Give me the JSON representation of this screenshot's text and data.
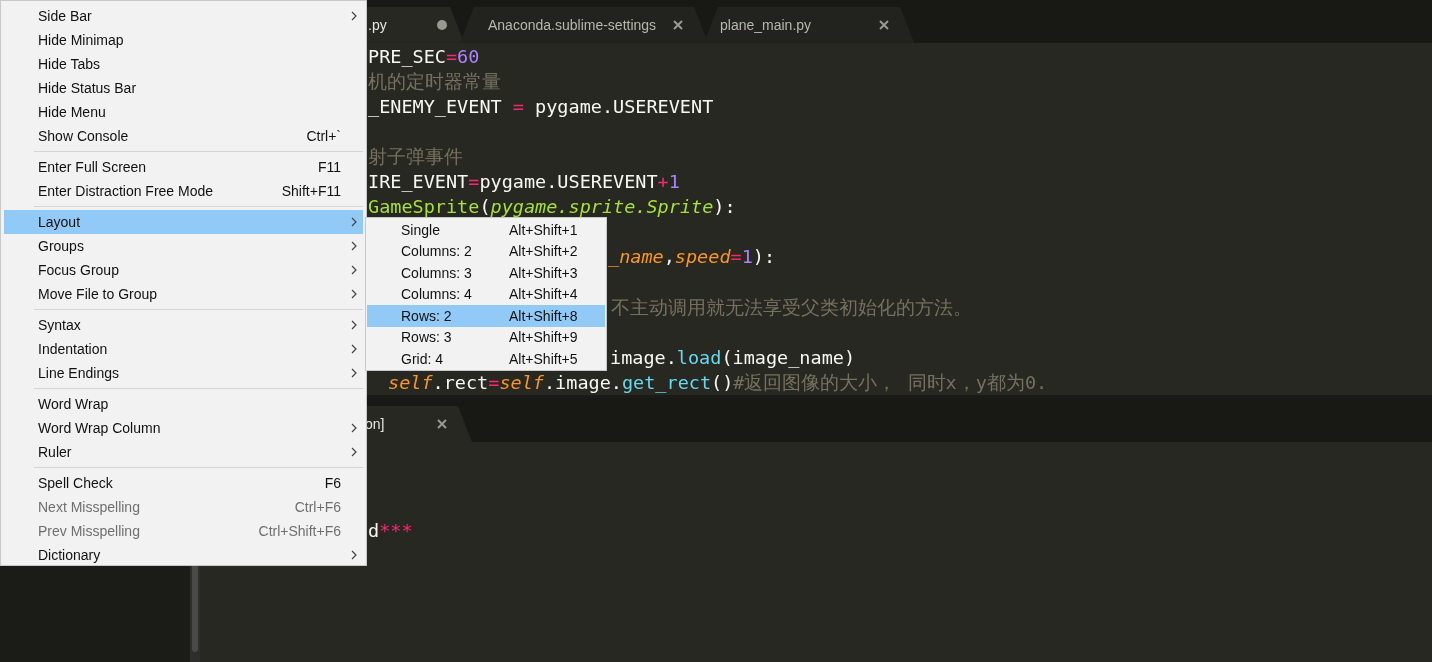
{
  "top_pane": {
    "tabs": [
      {
        "label": ".py",
        "selected": true,
        "dirty": true
      },
      {
        "label": "Anaconda.sublime-settings",
        "selected": false,
        "dirty": false
      },
      {
        "label": "plane_main.py",
        "selected": false,
        "dirty": false
      }
    ],
    "code_lines": [
      {
        "segments": [
          {
            "text": "PRE_SEC",
            "kind": "plain"
          },
          {
            "text": "=",
            "kind": "operator"
          },
          {
            "text": "60",
            "kind": "number"
          }
        ]
      },
      {
        "segments": [
          {
            "text": "机的定时器常量",
            "kind": "comment"
          }
        ]
      },
      {
        "segments": [
          {
            "text": "_ENEMY_EVENT ",
            "kind": "plain"
          },
          {
            "text": "=",
            "kind": "operator"
          },
          {
            "text": " pygame.USEREVENT",
            "kind": "plain"
          }
        ]
      },
      {
        "segments": [
          {
            "text": "射子弹事件",
            "kind": "comment"
          }
        ]
      },
      {
        "segments": [
          {
            "text": "IRE_EVENT",
            "kind": "plain"
          },
          {
            "text": "=",
            "kind": "operator"
          },
          {
            "text": "pygame.USEREVENT",
            "kind": "plain"
          },
          {
            "text": "+",
            "kind": "operator"
          },
          {
            "text": "1",
            "kind": "number"
          }
        ]
      },
      {
        "segments": [
          {
            "text": "GameSprite",
            "kind": "class"
          },
          {
            "text": "(",
            "kind": "plain"
          },
          {
            "text": "pygame.sprite.Sprite",
            "kind": "base"
          },
          {
            "text": "):",
            "kind": "plain"
          }
        ]
      },
      {
        "segments": [
          {
            "text": "_name",
            "kind": "param"
          },
          {
            "text": ",",
            "kind": "plain"
          },
          {
            "text": "speed",
            "kind": "param"
          },
          {
            "text": "=",
            "kind": "operator"
          },
          {
            "text": "1",
            "kind": "number"
          },
          {
            "text": "):",
            "kind": "plain"
          }
        ]
      },
      {
        "segments": [
          {
            "text": "不主动调用就无法享受父类初始化的方法。",
            "kind": "comment"
          }
        ]
      },
      {
        "segments": [
          {
            "text": "image.",
            "kind": "plain"
          },
          {
            "text": "load",
            "kind": "function"
          },
          {
            "text": "(image_name)",
            "kind": "plain"
          }
        ]
      },
      {
        "segments": [
          {
            "text": "self",
            "kind": "param"
          },
          {
            "text": ".rect",
            "kind": "plain"
          },
          {
            "text": "=",
            "kind": "operator"
          },
          {
            "text": "self",
            "kind": "param"
          },
          {
            "text": ".image.",
            "kind": "plain"
          },
          {
            "text": "get_rect",
            "kind": "function"
          },
          {
            "text": "()",
            "kind": "plain"
          },
          {
            "text": "#返回图像的大小， 同时x，y都为0.",
            "kind": "comment"
          }
        ]
      }
    ]
  },
  "bottom_pane": {
    "tabs": [
      {
        "label": "on]",
        "selected": true,
        "dirty": false
      }
    ],
    "code_lines": [
      {
        "segments": [
          {
            "text": "d",
            "kind": "plain"
          },
          {
            "text": "***",
            "kind": "operator"
          }
        ]
      }
    ]
  },
  "view_menu": {
    "sections": [
      [
        {
          "label": "Side Bar",
          "submenu": true,
          "selected": false,
          "disabled": false
        },
        {
          "label": "Hide Minimap",
          "submenu": false,
          "selected": false,
          "disabled": false
        },
        {
          "label": "Hide Tabs",
          "submenu": false,
          "selected": false,
          "disabled": false
        },
        {
          "label": "Hide Status Bar",
          "submenu": false,
          "selected": false,
          "disabled": false
        },
        {
          "label": "Hide Menu",
          "submenu": false,
          "selected": false,
          "disabled": false
        },
        {
          "label": "Show Console",
          "shortcut": "Ctrl+`",
          "submenu": false,
          "selected": false,
          "disabled": false
        }
      ],
      [
        {
          "label": "Enter Full Screen",
          "shortcut": "F11",
          "submenu": false,
          "selected": false,
          "disabled": false
        },
        {
          "label": "Enter Distraction Free Mode",
          "shortcut": "Shift+F11",
          "submenu": false,
          "selected": false,
          "disabled": false
        }
      ],
      [
        {
          "label": "Layout",
          "submenu": true,
          "selected": true,
          "disabled": false
        },
        {
          "label": "Groups",
          "submenu": true,
          "selected": false,
          "disabled": false
        },
        {
          "label": "Focus Group",
          "submenu": true,
          "selected": false,
          "disabled": false
        },
        {
          "label": "Move File to Group",
          "submenu": true,
          "selected": false,
          "disabled": false
        }
      ],
      [
        {
          "label": "Syntax",
          "submenu": true,
          "selected": false,
          "disabled": false
        },
        {
          "label": "Indentation",
          "submenu": true,
          "selected": false,
          "disabled": false
        },
        {
          "label": "Line Endings",
          "submenu": true,
          "selected": false,
          "disabled": false
        }
      ],
      [
        {
          "label": "Word Wrap",
          "submenu": false,
          "selected": false,
          "disabled": false
        },
        {
          "label": "Word Wrap Column",
          "submenu": true,
          "selected": false,
          "disabled": false
        },
        {
          "label": "Ruler",
          "submenu": true,
          "selected": false,
          "disabled": false
        }
      ],
      [
        {
          "label": "Spell Check",
          "shortcut": "F6",
          "submenu": false,
          "selected": false,
          "disabled": false
        },
        {
          "label": "Next Misspelling",
          "shortcut": "Ctrl+F6",
          "submenu": false,
          "selected": false,
          "disabled": true
        },
        {
          "label": "Prev Misspelling",
          "shortcut": "Ctrl+Shift+F6",
          "submenu": false,
          "selected": false,
          "disabled": true
        },
        {
          "label": "Dictionary",
          "submenu": true,
          "selected": false,
          "disabled": false
        }
      ]
    ]
  },
  "layout_submenu": {
    "items": [
      {
        "label": "Single",
        "shortcut": "Alt+Shift+1",
        "selected": false
      },
      {
        "label": "Columns: 2",
        "shortcut": "Alt+Shift+2",
        "selected": false
      },
      {
        "label": "Columns: 3",
        "shortcut": "Alt+Shift+3",
        "selected": false
      },
      {
        "label": "Columns: 4",
        "shortcut": "Alt+Shift+4",
        "selected": false
      },
      {
        "label": "Rows: 2",
        "shortcut": "Alt+Shift+8",
        "selected": true
      },
      {
        "label": "Rows: 3",
        "shortcut": "Alt+Shift+9",
        "selected": false
      },
      {
        "label": "Grid: 4",
        "shortcut": "Alt+Shift+5",
        "selected": false
      }
    ]
  }
}
